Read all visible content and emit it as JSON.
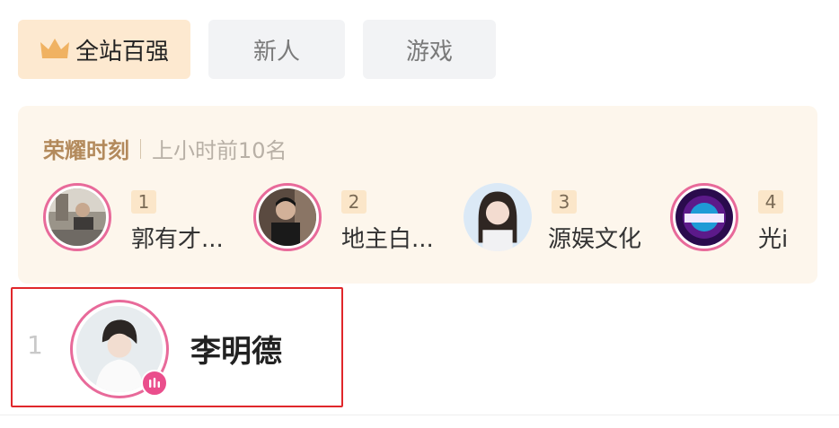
{
  "tabs": [
    {
      "label": "全站百强",
      "active": true
    },
    {
      "label": "新人",
      "active": false
    },
    {
      "label": "游戏",
      "active": false
    }
  ],
  "honor": {
    "title": "荣耀时刻",
    "subtitle": "上小时前10名",
    "ranks": [
      {
        "rank": "1",
        "name": "郭有才..."
      },
      {
        "rank": "2",
        "name": "地主白..."
      },
      {
        "rank": "3",
        "name": "源娱文化"
      },
      {
        "rank": "4",
        "name": "光i"
      }
    ]
  },
  "list": {
    "rows": [
      {
        "index": "1",
        "name": "李明德"
      }
    ]
  },
  "colors": {
    "accent": "#e86a9a",
    "tab_active_bg": "#fde9d0",
    "honor_bg": "#fdf6ec",
    "highlight_border": "#e0272b"
  }
}
